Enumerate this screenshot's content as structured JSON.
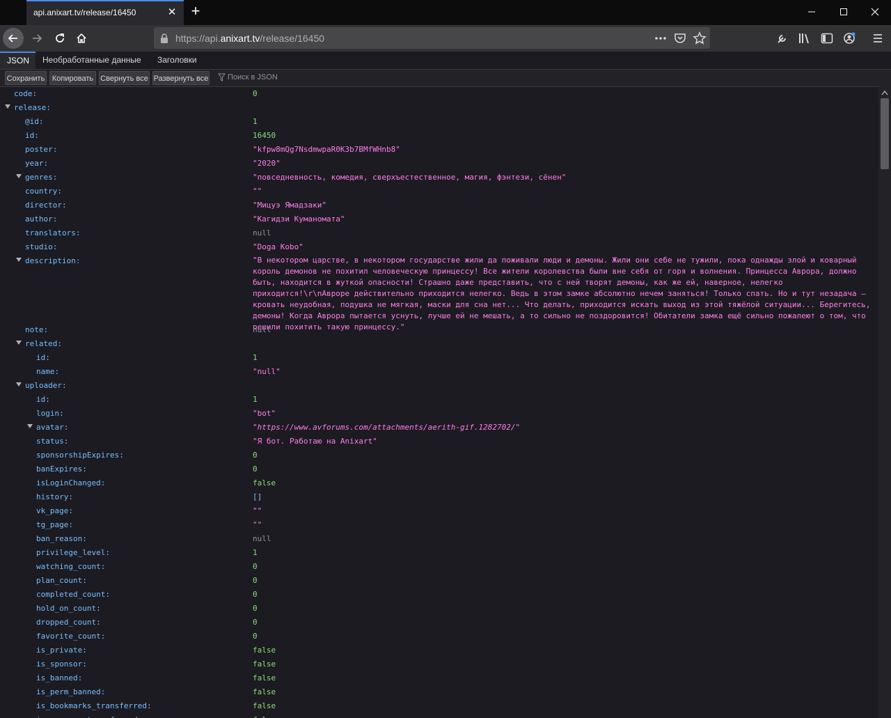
{
  "browser": {
    "tab_title": "api.anixart.tv/release/16450",
    "close_icon": "close-icon",
    "new_tab_icon": "plus-icon",
    "url_scheme": "https://api.",
    "url_host": "anixart.tv",
    "url_path": "/release/16450"
  },
  "viewer": {
    "tabs": [
      "JSON",
      "Необработанные данные",
      "Заголовки"
    ],
    "toolbar": {
      "save": "Сохранить",
      "copy": "Копировать",
      "collapse_all": "Свернуть все",
      "expand_all": "Развернуть все",
      "filter_placeholder": "Поиск в JSON"
    }
  },
  "json": {
    "code": {
      "key": "code:",
      "value": "0"
    },
    "release_key": "release:",
    "release": {
      "at_id": {
        "key": "@id:",
        "value": "1"
      },
      "id": {
        "key": "id:",
        "value": "16450"
      },
      "poster": {
        "key": "poster:",
        "value": "\"kfpw8mQg7NsdmwpaR0K3b7BMfWHnb8\""
      },
      "year": {
        "key": "year:",
        "value": "\"2020\""
      },
      "genres": {
        "key": "genres:",
        "value": "\"повседневность, комедия, сверхъестественное, магия, фэнтези, сёнен\""
      },
      "country": {
        "key": "country:",
        "value": "\"\""
      },
      "director": {
        "key": "director:",
        "value": "\"Мицуэ Ямадзаки\""
      },
      "author": {
        "key": "author:",
        "value": "\"Кагидзи Куманомата\""
      },
      "translators": {
        "key": "translators:",
        "value": "null"
      },
      "studio": {
        "key": "studio:",
        "value": "\"Doga Kobo\""
      },
      "description": {
        "key": "description:",
        "value": "\"В некотором царстве, в некотором государстве жили да поживали люди и демоны. Жили они себе не тужили, пока однажды злой и коварный король демонов не похитил человеческую принцессу! Все жители королевства были вне себя от горя и волнения. Принцесса Аврора, должно быть, находится в жуткой опасности! Страшно даже представить, что с ней творят демоны, как же ей, наверное, нелегко приходится!\\r\\nАвроре действительно приходится нелегко. Ведь в этом замке абсолютно нечем заняться! Только спать. Но и тут незадача — кровать неудобная, подушка не мягкая, маски для сна нет... Что делать, приходится искать выход из этой тяжёлой ситуации... Берегитесь, демоны! Когда Аврора пытается уснуть, лучше ей не мешать, а то сильно не поздоровится! Обитатели замка ещё сильно пожалеют о том, что решили похитить такую принцессу.\""
      },
      "note": {
        "key": "note:",
        "value": "null"
      },
      "related_key": "related:",
      "related": {
        "id": {
          "key": "id:",
          "value": "1"
        },
        "name": {
          "key": "name:",
          "value": "\"null\""
        }
      },
      "uploader_key": "uploader:",
      "uploader": {
        "id": {
          "key": "id:",
          "value": "1"
        },
        "login": {
          "key": "login:",
          "value": "\"bot\""
        },
        "avatar": {
          "key": "avatar:",
          "value": "\"https://www.avforums.com/attachments/aerith-gif.1282702/\""
        },
        "status": {
          "key": "status:",
          "value": "\"Я бот. Работаю на Anixart\""
        },
        "sponsorshipExpires": {
          "key": "sponsorshipExpires:",
          "value": "0"
        },
        "banExpires": {
          "key": "banExpires:",
          "value": "0"
        },
        "isLoginChanged": {
          "key": "isLoginChanged:",
          "value": "false"
        },
        "history": {
          "key": "history:",
          "value": "[]"
        },
        "vk_page": {
          "key": "vk_page:",
          "value": "\"\""
        },
        "tg_page": {
          "key": "tg_page:",
          "value": "\"\""
        },
        "ban_reason": {
          "key": "ban_reason:",
          "value": "null"
        },
        "privilege_level": {
          "key": "privilege_level:",
          "value": "1"
        },
        "watching_count": {
          "key": "watching_count:",
          "value": "0"
        },
        "plan_count": {
          "key": "plan_count:",
          "value": "0"
        },
        "completed_count": {
          "key": "completed_count:",
          "value": "0"
        },
        "hold_on_count": {
          "key": "hold_on_count:",
          "value": "0"
        },
        "dropped_count": {
          "key": "dropped_count:",
          "value": "0"
        },
        "favorite_count": {
          "key": "favorite_count:",
          "value": "0"
        },
        "is_private": {
          "key": "is_private:",
          "value": "false"
        },
        "is_sponsor": {
          "key": "is_sponsor:",
          "value": "false"
        },
        "is_banned": {
          "key": "is_banned:",
          "value": "false"
        },
        "is_perm_banned": {
          "key": "is_perm_banned:",
          "value": "false"
        },
        "is_bookmarks_transferred": {
          "key": "is_bookmarks_transferred:",
          "value": "false"
        },
        "is_sponsor_transferred": {
          "key": "is_sponsor_transferred:",
          "value": "false"
        }
      }
    }
  }
}
